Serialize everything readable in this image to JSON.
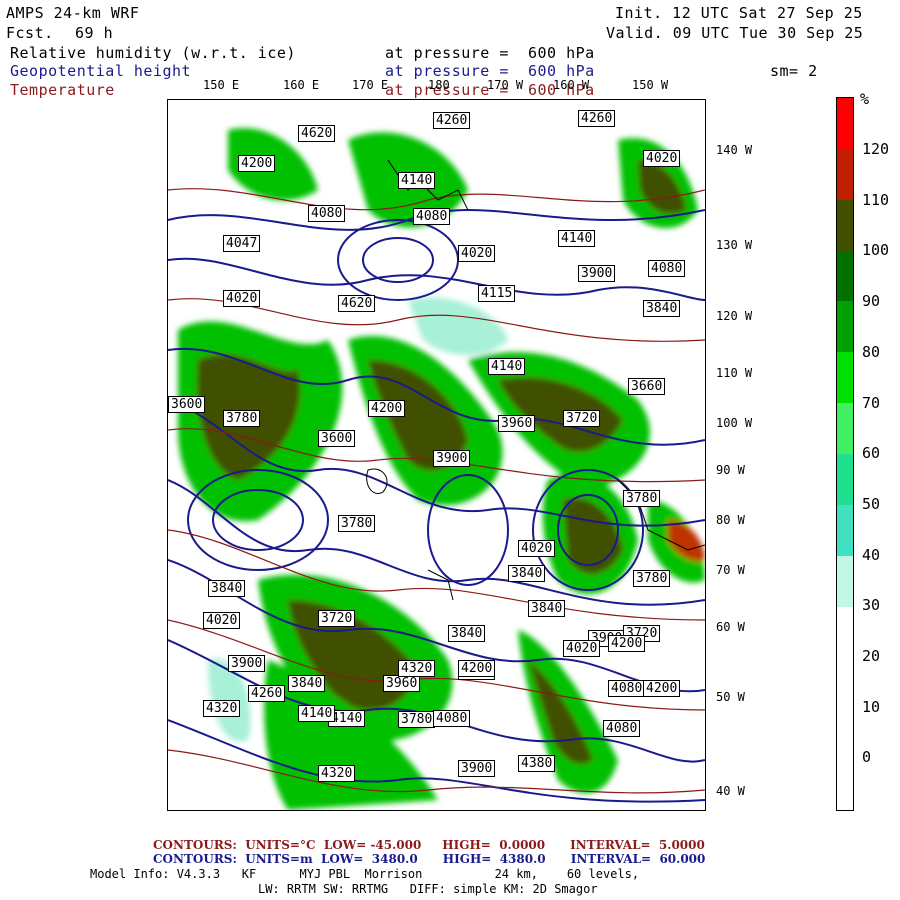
{
  "header": {
    "model": "AMPS 24-km WRF",
    "fcst_label": "Fcst.",
    "fcst_value": "69 h",
    "init": "Init. 12 UTC Sat 27 Sep 25",
    "valid": "Valid. 09 UTC Tue 30 Sep 25",
    "field1": "Relative humidity (w.r.t. ice)",
    "field1_level": "at pressure =  600 hPa",
    "field2": "Geopotential height",
    "field2_level": "at pressure =  600 hPa",
    "smoothing": "sm= 2",
    "field3": "Temperature",
    "field3_level": "at pressure =  600 hPa"
  },
  "colors": {
    "height_contour": "#1a1a8c",
    "temperature_contour": "#8b1a1a",
    "rh_30": "#a8f0d8",
    "rh_50": "#00d080",
    "rh_70": "#00c000",
    "rh_90": "#007000",
    "rh_100": "#405000",
    "rh_110": "#c03000",
    "rh_120": "#ff0000"
  },
  "longitude_labels": [
    "150 E",
    "160 E",
    "170 E",
    "180",
    "170 W",
    "160 W",
    "150 W"
  ],
  "latitude_labels": [
    "140 W",
    "130 W",
    "120 W",
    "110 W",
    "100 W",
    "90 W",
    "80 W",
    "70 W",
    "60 W",
    "50 W",
    "40 W"
  ],
  "colorbar": {
    "unit": "%",
    "labels": [
      "120",
      "110",
      "100",
      "90",
      "80",
      "70",
      "60",
      "50",
      "40",
      "30",
      "20",
      "10",
      "0"
    ],
    "segments": [
      "#ff0000",
      "#c02000",
      "#405000",
      "#007000",
      "#00a000",
      "#00e000",
      "#40f060",
      "#20e090",
      "#40e0c0",
      "#c0f8e8",
      "#ffffff",
      "#ffffff",
      "#ffffff",
      "#ffffff"
    ]
  },
  "height_labels": [
    "4620",
    "4260",
    "4260",
    "4380",
    "4200",
    "4080",
    "4140",
    "4080",
    "4047",
    "4020",
    "4140",
    "4080",
    "4020",
    "4620",
    "4115",
    "3840",
    "3900",
    "4140",
    "4200",
    "3960",
    "3600",
    "3900",
    "3780",
    "4020",
    "3780",
    "3840",
    "3840",
    "3720",
    "3840",
    "3840",
    "3780",
    "3660",
    "3600",
    "3720",
    "4020",
    "3780",
    "3900",
    "3840",
    "3900",
    "3720",
    "4080",
    "4020",
    "4320",
    "4200",
    "4080",
    "4200",
    "3960",
    "3780",
    "4320",
    "4140",
    "4080",
    "3900",
    "4020",
    "4080",
    "4380",
    "4320",
    "4260",
    "4140",
    "4200"
  ],
  "footer": {
    "temp_contours": "CONTOURS:  UNITS=°C  LOW= -45.000     HIGH=  0.0000      INTERVAL=  5.0000",
    "height_contours": "CONTOURS:  UNITS=m  LOW=  3480.0      HIGH=  4380.0      INTERVAL=  60.000",
    "model_info": "Model Info: V4.3.3   KF      MYJ PBL  Morrison          24 km,    60 levels,",
    "model_info2": "LW: RRTM SW: RRTMG   DIFF: simple KM: 2D Smagor"
  }
}
